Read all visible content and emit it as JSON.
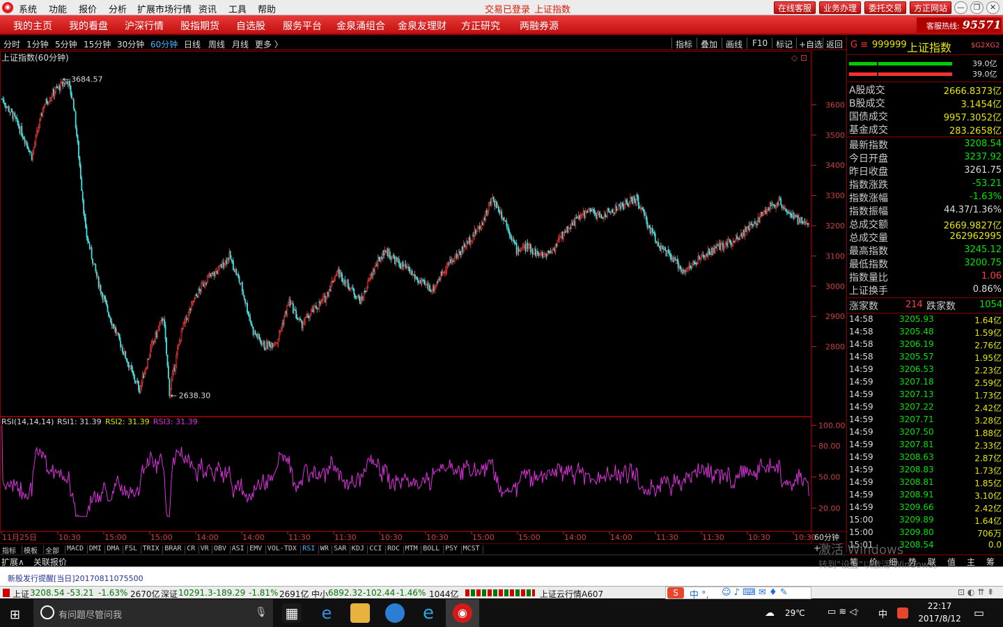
{
  "titlebar": {
    "menus": [
      "系统",
      "功能",
      "报价",
      "分析",
      "扩展市场行情",
      "资讯",
      "工具",
      "帮助"
    ],
    "status_login": "交易已登录",
    "status_name": "上证指数",
    "buttons": [
      "在线客服",
      "业务办理",
      "委托交易",
      "方正网站"
    ],
    "min": "—",
    "restore": "❐",
    "close": "✕"
  },
  "nav": {
    "items": [
      "我的主页",
      "我的看盘",
      "沪深行情",
      "股指期货",
      "自选股",
      "服务平台",
      "金泉涌组合",
      "金泉友理财",
      "方正研究",
      "两融券源"
    ],
    "hotline_label": "客服热线:",
    "hotline_number": "95571"
  },
  "period": {
    "items": [
      "分时",
      "1分钟",
      "5分钟",
      "15分钟",
      "30分钟",
      "60分钟",
      "日线",
      "周线",
      "月线",
      "更多 〉"
    ],
    "active": "60分钟",
    "tools": [
      "指标",
      "叠加",
      "画线",
      "F10",
      "标记",
      "+自选",
      "返回"
    ]
  },
  "chart": {
    "title": "上证指数(60分钟)",
    "high_label": "3684.57",
    "low_label": "2638.30",
    "price_ticks": [
      "3600",
      "3500",
      "3400",
      "3300",
      "3200",
      "3100",
      "3000",
      "2900",
      "2800"
    ],
    "rsi_title": "RSI(14,14,14)",
    "rsi1": "RSI1: 31.39",
    "rsi2": "RSI2: 31.39",
    "rsi3": "RSI3: 31.39",
    "rsi_ticks": [
      "100.00",
      "80.00",
      "50.00",
      "20.00"
    ],
    "time_labels": [
      "11月25日",
      "10:30",
      "15:00",
      "15:00",
      "14:00",
      "14:00",
      "11:30",
      "11:30",
      "10:30",
      "10:30",
      "15:00",
      "15:00",
      "14:00",
      "14:00",
      "11:30",
      "11:30",
      "10:30",
      "10:30"
    ],
    "period_label": "60分钟",
    "high_marker": "←",
    "low_marker": "←",
    "corner_icons": "◇ ⊡"
  },
  "chart_data": {
    "type": "candlestick",
    "title": "上证指数(60分钟)",
    "ylim": [
      2580,
      3760
    ],
    "y_ticks": [
      3600,
      3500,
      3400,
      3300,
      3200,
      3100,
      3000,
      2900,
      2800
    ],
    "high": 3684.57,
    "low": 2638.3,
    "close_series_points": [
      [
        0,
        3620
      ],
      [
        2,
        3560
      ],
      [
        4,
        3480
      ],
      [
        5,
        3430
      ],
      [
        7,
        3600
      ],
      [
        9,
        3650
      ],
      [
        11,
        3680
      ],
      [
        12,
        3600
      ],
      [
        13,
        3400
      ],
      [
        14,
        3180
      ],
      [
        16,
        3020
      ],
      [
        18,
        2900
      ],
      [
        20,
        2800
      ],
      [
        22,
        2700
      ],
      [
        23,
        2660
      ],
      [
        25,
        2800
      ],
      [
        27,
        2900
      ],
      [
        28,
        2650
      ],
      [
        30,
        2850
      ],
      [
        32,
        2950
      ],
      [
        34,
        3020
      ],
      [
        36,
        3050
      ],
      [
        38,
        3100
      ],
      [
        40,
        3000
      ],
      [
        42,
        2850
      ],
      [
        44,
        2800
      ],
      [
        46,
        2820
      ],
      [
        48,
        2950
      ],
      [
        50,
        2870
      ],
      [
        52,
        2920
      ],
      [
        54,
        2960
      ],
      [
        56,
        3050
      ],
      [
        58,
        3000
      ],
      [
        60,
        2950
      ],
      [
        62,
        3050
      ],
      [
        64,
        3120
      ],
      [
        66,
        3080
      ],
      [
        68,
        3050
      ],
      [
        70,
        3010
      ],
      [
        72,
        2990
      ],
      [
        74,
        3060
      ],
      [
        76,
        3100
      ],
      [
        78,
        3150
      ],
      [
        80,
        3200
      ],
      [
        82,
        3290
      ],
      [
        84,
        3220
      ],
      [
        86,
        3120
      ],
      [
        88,
        3130
      ],
      [
        90,
        3100
      ],
      [
        92,
        3120
      ],
      [
        94,
        3180
      ],
      [
        96,
        3220
      ],
      [
        98,
        3250
      ],
      [
        100,
        3230
      ],
      [
        102,
        3250
      ],
      [
        104,
        3270
      ],
      [
        106,
        3290
      ],
      [
        108,
        3200
      ],
      [
        110,
        3130
      ],
      [
        112,
        3090
      ],
      [
        114,
        3050
      ],
      [
        116,
        3080
      ],
      [
        118,
        3110
      ],
      [
        120,
        3130
      ],
      [
        122,
        3150
      ],
      [
        124,
        3180
      ],
      [
        126,
        3210
      ],
      [
        128,
        3260
      ],
      [
        130,
        3280
      ],
      [
        132,
        3230
      ],
      [
        134,
        3209
      ]
    ],
    "rsi_ylim": [
      0,
      105
    ],
    "rsi_ticks": [
      100,
      80,
      50,
      20
    ],
    "rsi_value": 31.39
  },
  "tabs": {
    "indicators": [
      "指标",
      "模板",
      "全部",
      "MACD",
      "DMI",
      "DMA",
      "FSL",
      "TRIX",
      "BRAR",
      "CR",
      "VR",
      "OBV",
      "ASI",
      "EMV",
      "VOL-TDX",
      "RSI",
      "WR",
      "SAR",
      "KDJ",
      "CCI",
      "ROC",
      "MTM",
      "BOLL",
      "PSY",
      "MCST"
    ],
    "active": "RSI",
    "row2": [
      "扩展∧",
      "关联报价"
    ],
    "plus": "+"
  },
  "notice": "新股发行提醒[当日]20170811075500",
  "status": {
    "sh_name": "上证",
    "sh_val": "3208.54",
    "sh_chg": "-53.21",
    "sh_pct": "-1.63%",
    "sh_amt": "2670亿",
    "sz_name": "深证",
    "sz_val": "10291.3",
    "sz_chg": "-189.29",
    "sz_pct": "-1.81%",
    "sz_amt": "2691亿",
    "zx_name": "中小",
    "zx_val": "6892.32",
    "zx_chg": "-102.44",
    "zx_pct": "-1.46%",
    "zx_amt": "1044亿",
    "cloud": "上证云行情A607",
    "ime": "中 °,"
  },
  "right": {
    "code_prefix": "G ≡",
    "code": "999999",
    "name": "上证指数",
    "tag": "$G2XG2",
    "bar1": "39.0亿",
    "bar2": "39.0亿",
    "volumes": [
      {
        "label": "A股成交",
        "value": "2666.8373亿"
      },
      {
        "label": "B股成交",
        "value": "3.1454亿"
      },
      {
        "label": "国债成交",
        "value": "9957.3052亿"
      },
      {
        "label": "基金成交",
        "value": "283.2658亿"
      }
    ],
    "stats": [
      {
        "label": "最新指数",
        "value": "3208.54",
        "c": "vg"
      },
      {
        "label": "今日开盘",
        "value": "3237.92",
        "c": "vg"
      },
      {
        "label": "昨日收盘",
        "value": "3261.75",
        "c": "vw"
      },
      {
        "label": "指数涨跌",
        "value": "-53.21",
        "c": "vg"
      },
      {
        "label": "指数涨幅",
        "value": "-1.63%",
        "c": "vg"
      },
      {
        "label": "指数振幅",
        "value": "44.37/1.36%",
        "c": "vw"
      },
      {
        "label": "总成交额",
        "value": "2669.9827亿",
        "c": "vy"
      },
      {
        "label": "总成交量",
        "value": "262962995",
        "c": "vy"
      },
      {
        "label": "最高指数",
        "value": "3245.12",
        "c": "vg"
      },
      {
        "label": "最低指数",
        "value": "3200.75",
        "c": "vg"
      },
      {
        "label": "指数量比",
        "value": "1.06",
        "c": "vr"
      },
      {
        "label": "上证换手",
        "value": "0.86%",
        "c": "vw"
      }
    ],
    "rise_label": "涨家数",
    "rise": "214",
    "fall_label": "跌家数",
    "fall": "1054",
    "ticks": [
      [
        "14:58",
        "3205.93",
        "1.64亿"
      ],
      [
        "14:58",
        "3205.48",
        "1.59亿"
      ],
      [
        "14:58",
        "3206.19",
        "2.76亿"
      ],
      [
        "14:58",
        "3205.57",
        "1.95亿"
      ],
      [
        "14:59",
        "3206.53",
        "2.23亿"
      ],
      [
        "14:59",
        "3207.18",
        "2.59亿"
      ],
      [
        "14:59",
        "3207.13",
        "1.73亿"
      ],
      [
        "14:59",
        "3207.22",
        "2.42亿"
      ],
      [
        "14:59",
        "3207.71",
        "3.28亿"
      ],
      [
        "14:59",
        "3207.50",
        "1.88亿"
      ],
      [
        "14:59",
        "3207.81",
        "2.33亿"
      ],
      [
        "14:59",
        "3208.63",
        "2.87亿"
      ],
      [
        "14:59",
        "3208.83",
        "1.73亿"
      ],
      [
        "14:59",
        "3208.81",
        "1.85亿"
      ],
      [
        "14:59",
        "3208.91",
        "3.10亿"
      ],
      [
        "14:59",
        "3209.66",
        "2.42亿"
      ],
      [
        "15:00",
        "3209.89",
        "1.64亿"
      ],
      [
        "15:00",
        "3209.80",
        "706万"
      ],
      [
        "15:01",
        "3208.54",
        "0.0"
      ]
    ],
    "bottom_tabs": [
      "笔",
      "价",
      "细",
      "势",
      "联",
      "值",
      "主",
      "筹"
    ]
  },
  "watermark": {
    "line1": "激活 Windows",
    "line2": "转到\"设置\"以激活 Windows。"
  },
  "taskbar": {
    "search": "有问题尽管问我",
    "weather": "29℃",
    "time": "22:17",
    "date": "2017/8/12",
    "ime": "中"
  }
}
